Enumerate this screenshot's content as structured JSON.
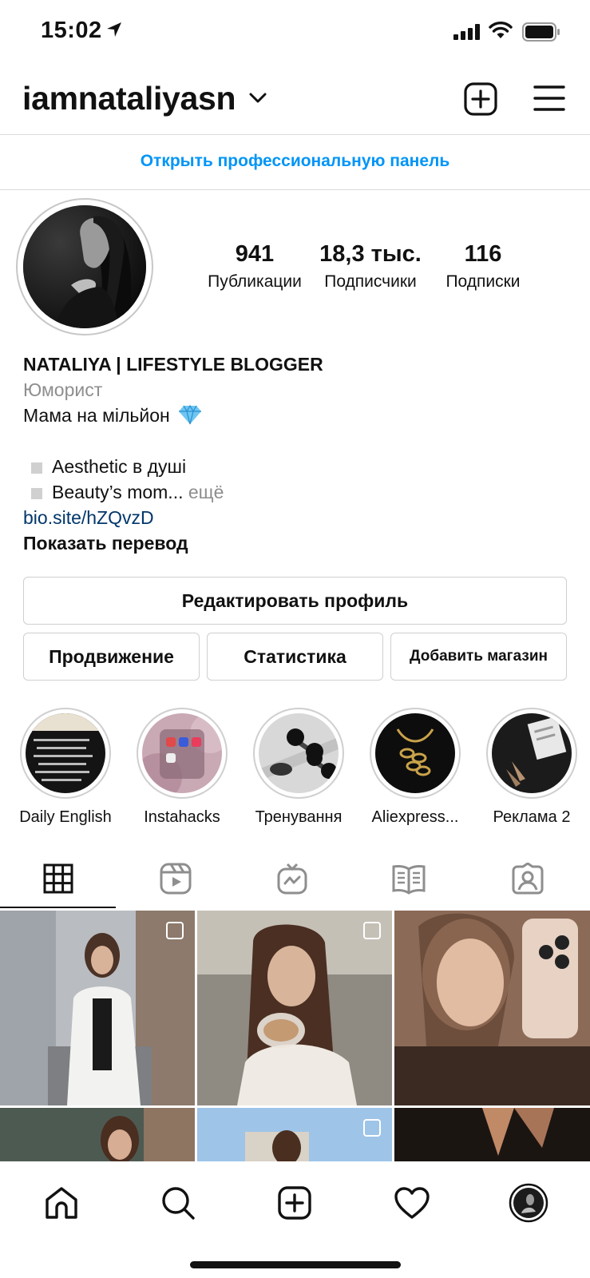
{
  "status_bar": {
    "time": "15:02"
  },
  "header": {
    "username": "iamnataliyasn"
  },
  "pro_panel": {
    "label": "Открыть профессиональную панель"
  },
  "stats": [
    {
      "value": "941",
      "label": "Публикации"
    },
    {
      "value": "18,3 тыс.",
      "label": "Подписчики"
    },
    {
      "value": "116",
      "label": "Подписки"
    }
  ],
  "bio": {
    "name": "NATALIYA | LIFESTYLE BLOGGER",
    "category": "Юморист",
    "line1": "Мама на мільйон",
    "bullet1": "Aesthetic в душі",
    "bullet2": "Beauty’s mom...",
    "more": "ещё",
    "link": "bio.site/hZQvzD",
    "translate": "Показать перевод"
  },
  "buttons": {
    "edit_profile": "Редактировать профиль",
    "promote": "Продвижение",
    "insights": "Статистика",
    "add_shop": "Добавить магазин"
  },
  "highlights": [
    {
      "label": "Daily English"
    },
    {
      "label": "Instahacks"
    },
    {
      "label": "Тренування"
    },
    {
      "label": "Aliexpress..."
    },
    {
      "label": "Реклама 2"
    }
  ],
  "colors": {
    "link_blue": "#0095f6",
    "bio_link": "#00376b",
    "muted": "#8e8e8e",
    "border": "#dbdbdb"
  }
}
